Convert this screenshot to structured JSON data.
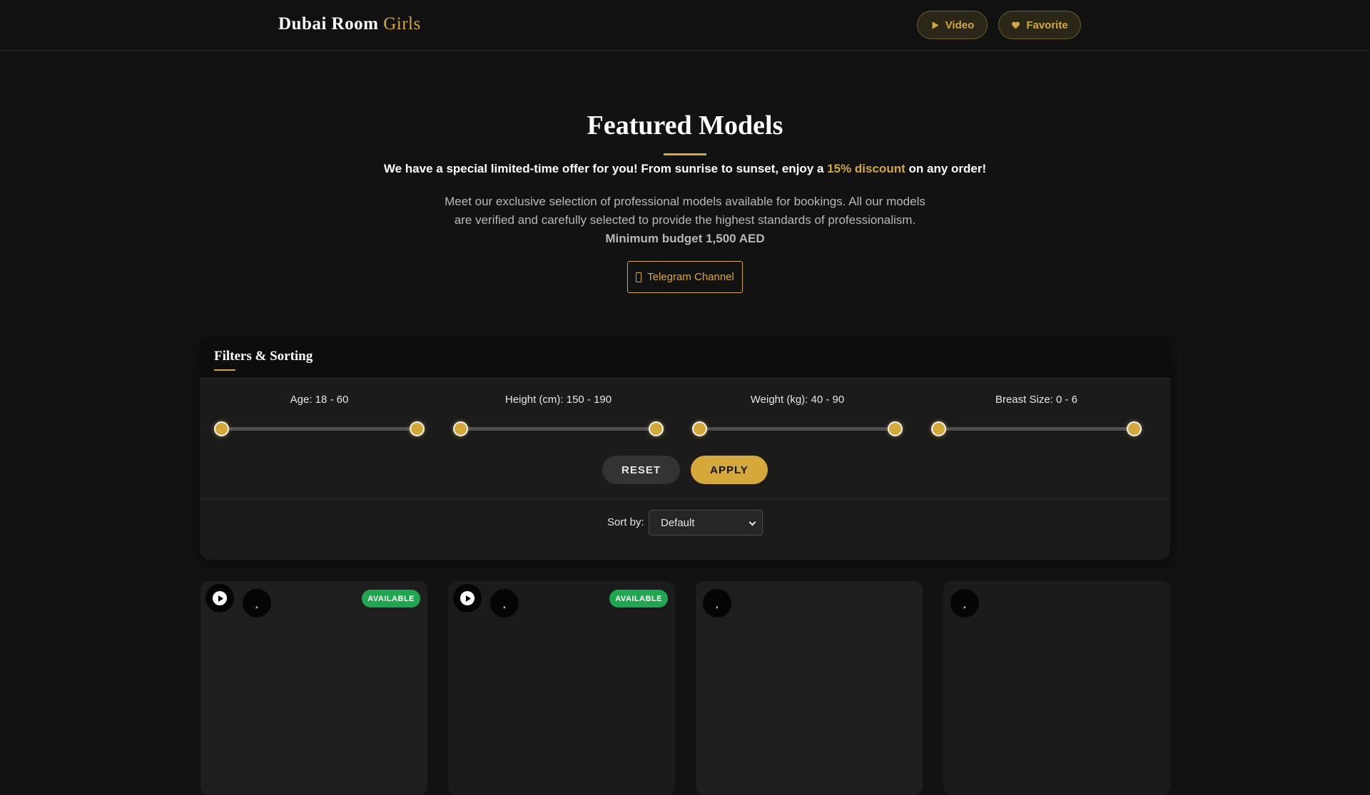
{
  "header": {
    "brand_main": "Dubai Room",
    "brand_accent": "Girls",
    "video_label": "Video",
    "favorite_label": "Favorite"
  },
  "hero": {
    "title": "Featured Models",
    "offer_before": "We have a special limited-time offer for you! From sunrise to sunset, enjoy a",
    "offer_highlight": "15% discount",
    "offer_after": "on any order!",
    "description": "Meet our exclusive selection of professional models available for bookings. All our models are verified and carefully selected to provide the highest standards of professionalism.",
    "description_bold": "Minimum budget 1,500 AED",
    "telegram_label": "Telegram Channel"
  },
  "filters": {
    "title": "Filters & Sorting",
    "sliders": [
      {
        "label": "Age: 18 - 60",
        "min": 18,
        "max": 60,
        "low": 18,
        "high": 60
      },
      {
        "label": "Height (cm): 150 - 190",
        "min": 150,
        "max": 190,
        "low": 150,
        "high": 190
      },
      {
        "label": "Weight (kg): 40 - 90",
        "min": 40,
        "max": 90,
        "low": 40,
        "high": 90
      },
      {
        "label": "Breast Size: 0 - 6",
        "min": 0,
        "max": 6,
        "low": 0,
        "high": 6
      }
    ],
    "reset_label": "RESET",
    "apply_label": "APPLY",
    "sort_label": "Sort by:",
    "sort_value": "Default"
  },
  "cards": [
    {
      "has_video": true,
      "status": "AVAILABLE",
      "fav_glyph": "¸"
    },
    {
      "has_video": true,
      "status": "AVAILABLE",
      "fav_glyph": "¸"
    },
    {
      "has_video": false,
      "status": "",
      "fav_glyph": "¸"
    },
    {
      "has_video": false,
      "status": "",
      "fav_glyph": "¸"
    }
  ],
  "colors": {
    "accent": "#d4a93a",
    "available": "#1fa750",
    "background": "#121212"
  },
  "icons": {
    "video": "play-icon",
    "favorite": "heart-icon",
    "telegram": "telegram-icon",
    "sort": "chevron-down-icon"
  }
}
